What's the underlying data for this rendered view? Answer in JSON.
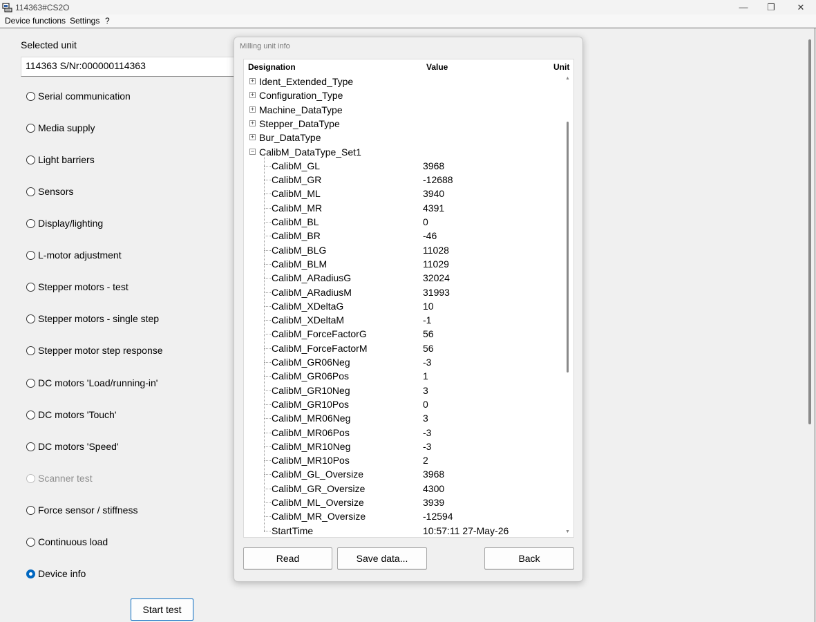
{
  "window": {
    "title": "114363#CS2O",
    "minimize": "—",
    "maximize": "❐",
    "close": "✕"
  },
  "menu": [
    "Device functions",
    "Settings",
    "?"
  ],
  "left": {
    "selected_unit_label": "Selected unit",
    "selected_unit_value": "114363 S/Nr:000000114363",
    "options": [
      {
        "label": "Serial communication",
        "checked": false,
        "disabled": false
      },
      {
        "label": "Media supply",
        "checked": false,
        "disabled": false
      },
      {
        "label": "Light barriers",
        "checked": false,
        "disabled": false
      },
      {
        "label": "Sensors",
        "checked": false,
        "disabled": false
      },
      {
        "label": "Display/lighting",
        "checked": false,
        "disabled": false
      },
      {
        "label": "L-motor adjustment",
        "checked": false,
        "disabled": false
      },
      {
        "label": "Stepper motors - test",
        "checked": false,
        "disabled": false
      },
      {
        "label": "Stepper motors - single step",
        "checked": false,
        "disabled": false
      },
      {
        "label": "Stepper motor step response",
        "checked": false,
        "disabled": false
      },
      {
        "label": "DC motors 'Load/running-in'",
        "checked": false,
        "disabled": false
      },
      {
        "label": "DC motors 'Touch'",
        "checked": false,
        "disabled": false
      },
      {
        "label": "DC motors 'Speed'",
        "checked": false,
        "disabled": false
      },
      {
        "label": "Scanner test",
        "checked": false,
        "disabled": true
      },
      {
        "label": "Force sensor / stiffness",
        "checked": false,
        "disabled": false
      },
      {
        "label": "Continuous load",
        "checked": false,
        "disabled": false
      },
      {
        "label": "Device info",
        "checked": true,
        "disabled": false
      }
    ],
    "start_button": "Start test"
  },
  "dialog": {
    "title": "Milling unit info",
    "columns": {
      "designation": "Designation",
      "value": "Value",
      "unit": "Unit"
    },
    "groups_collapsed": [
      "Ident_Extended_Type",
      "Configuration_Type",
      "Machine_DataType",
      "Stepper_DataType",
      "Bur_DataType"
    ],
    "group_expanded": "CalibM_DataType_Set1",
    "entries": [
      {
        "name": "CalibM_GL",
        "value": "3968"
      },
      {
        "name": "CalibM_GR",
        "value": "-12688"
      },
      {
        "name": "CalibM_ML",
        "value": "3940"
      },
      {
        "name": "CalibM_MR",
        "value": "4391"
      },
      {
        "name": "CalibM_BL",
        "value": "0"
      },
      {
        "name": "CalibM_BR",
        "value": "-46"
      },
      {
        "name": "CalibM_BLG",
        "value": "11028"
      },
      {
        "name": "CalibM_BLM",
        "value": "11029"
      },
      {
        "name": "CalibM_ARadiusG",
        "value": "32024"
      },
      {
        "name": "CalibM_ARadiusM",
        "value": "31993"
      },
      {
        "name": "CalibM_XDeltaG",
        "value": "10"
      },
      {
        "name": "CalibM_XDeltaM",
        "value": "-1"
      },
      {
        "name": "CalibM_ForceFactorG",
        "value": "56"
      },
      {
        "name": "CalibM_ForceFactorM",
        "value": "56"
      },
      {
        "name": "CalibM_GR06Neg",
        "value": "-3"
      },
      {
        "name": "CalibM_GR06Pos",
        "value": "1"
      },
      {
        "name": "CalibM_GR10Neg",
        "value": "3"
      },
      {
        "name": "CalibM_GR10Pos",
        "value": "0"
      },
      {
        "name": "CalibM_MR06Neg",
        "value": "3"
      },
      {
        "name": "CalibM_MR06Pos",
        "value": "-3"
      },
      {
        "name": "CalibM_MR10Neg",
        "value": "-3"
      },
      {
        "name": "CalibM_MR10Pos",
        "value": "2"
      },
      {
        "name": "CalibM_GL_Oversize",
        "value": "3968"
      },
      {
        "name": "CalibM_GR_Oversize",
        "value": "4300"
      },
      {
        "name": "CalibM_ML_Oversize",
        "value": "3939"
      },
      {
        "name": "CalibM_MR_Oversize",
        "value": "-12594"
      },
      {
        "name": "StartTime",
        "value": "10:57:11 27-May-26"
      }
    ],
    "buttons": {
      "read": "Read",
      "save": "Save data...",
      "back": "Back"
    }
  }
}
